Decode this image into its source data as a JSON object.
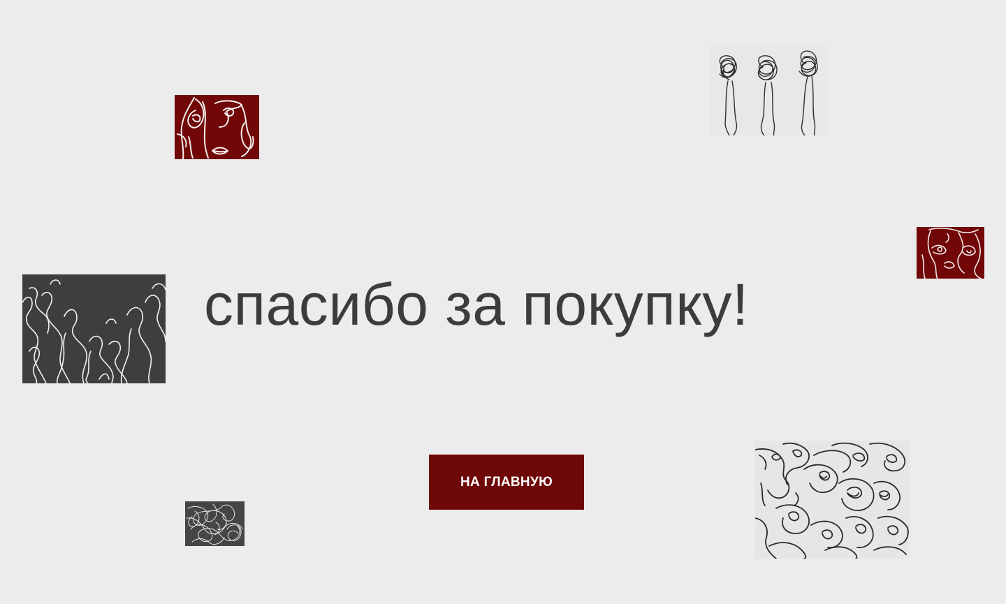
{
  "main": {
    "title": "спасибо за покупку!",
    "home_button_label": "НА ГЛАВНУЮ"
  },
  "artworks": [
    {
      "name": "faces-red-1",
      "style": "white line faces on dark red"
    },
    {
      "name": "scribble-figures",
      "style": "black scribble heads on light grey"
    },
    {
      "name": "faces-red-2",
      "style": "white line faces on dark red"
    },
    {
      "name": "crowd-dark",
      "style": "white line crowd on dark grey"
    },
    {
      "name": "scribble-dark",
      "style": "white scribble on dark grey"
    },
    {
      "name": "faces-collage",
      "style": "black line faces on light grey"
    }
  ],
  "colors": {
    "background": "#ececec",
    "accent": "#6e0707",
    "text": "#3c3c3c",
    "dark_panel": "#3e3e3e"
  }
}
